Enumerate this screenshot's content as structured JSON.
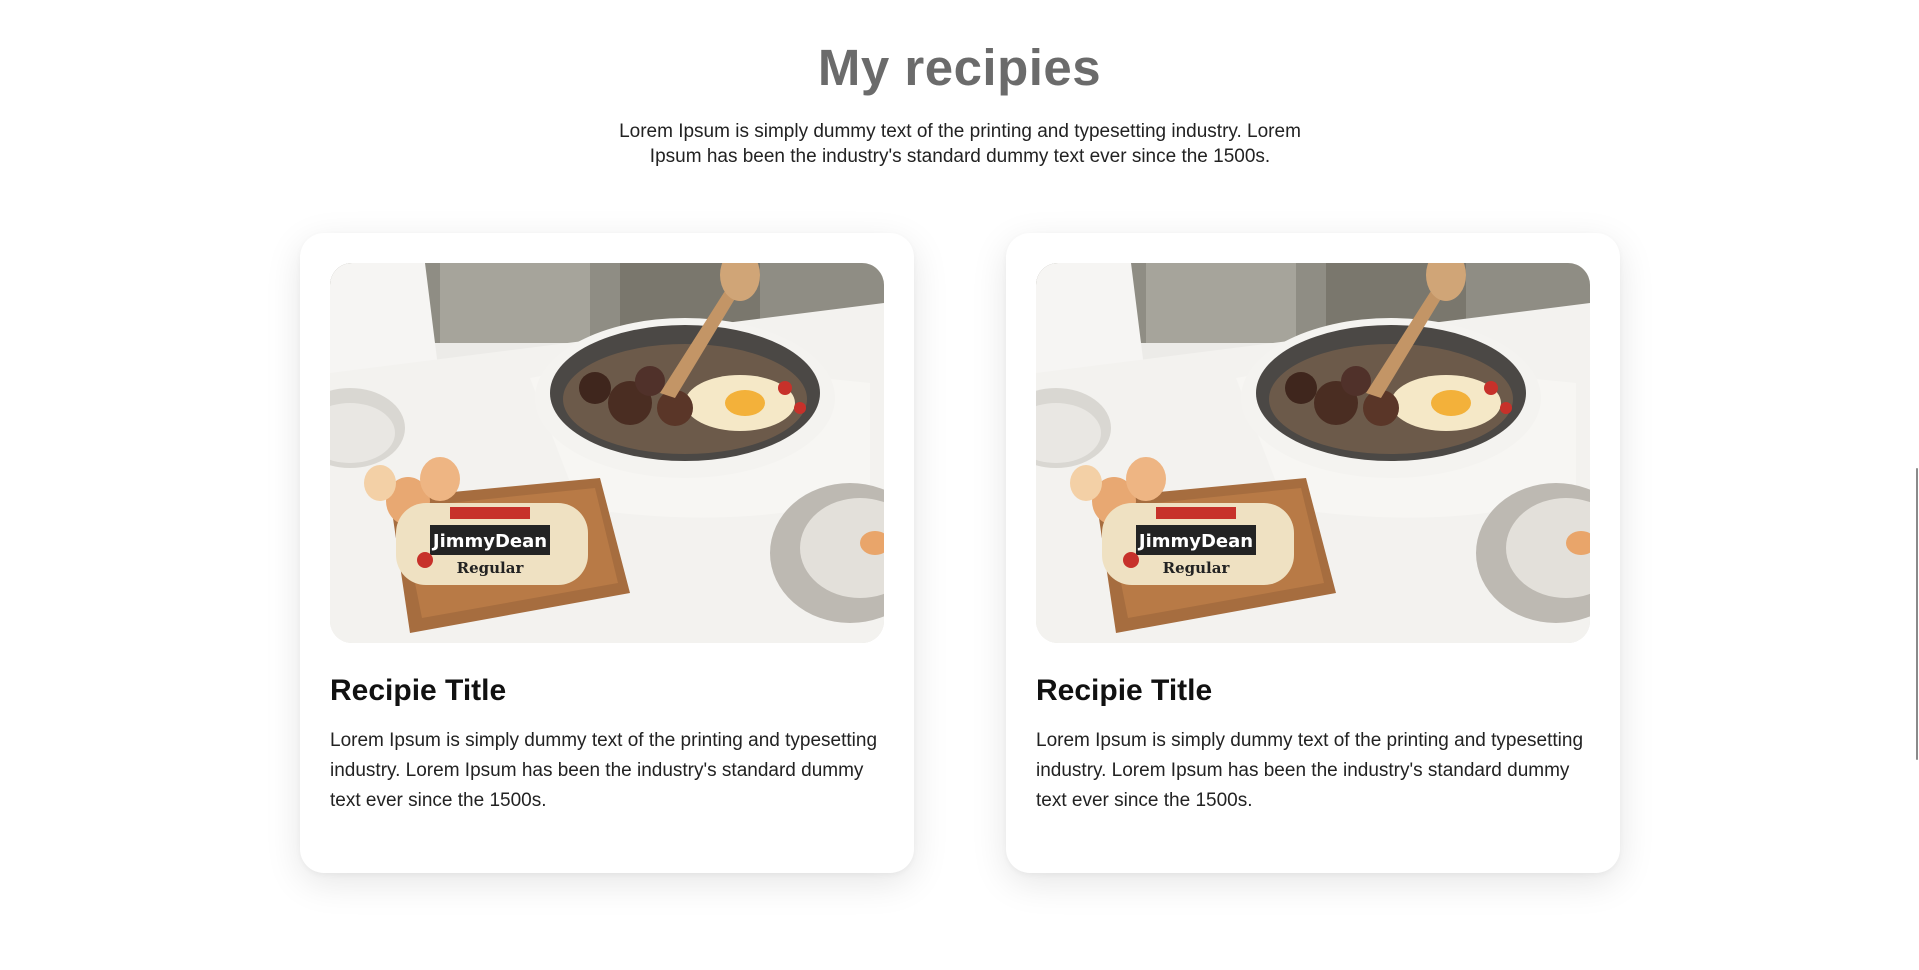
{
  "section": {
    "title": "My recipies",
    "intro": "Lorem Ipsum is simply dummy text of the printing and typesetting industry. Lorem Ipsum has been the industry's standard dummy text ever since the 1500s."
  },
  "recipes": [
    {
      "title": "Recipie Title",
      "description": "Lorem Ipsum is simply dummy text of the printing and typesetting industry. Lorem Ipsum has been the industry's standard dummy text ever since the 1500s.",
      "image_icon": "food-photo-icon",
      "package_brand": "JimmyDean",
      "package_variant": "Regular"
    },
    {
      "title": "Recipie Title",
      "description": "Lorem Ipsum is simply dummy text of the printing and typesetting industry. Lorem Ipsum has been the industry's standard dummy text ever since the 1500s.",
      "image_icon": "food-photo-icon",
      "package_brand": "JimmyDean",
      "package_variant": "Regular"
    }
  ],
  "colors": {
    "title": "#6b6b6b",
    "text": "#222222",
    "heading": "#111111",
    "background": "#ffffff"
  }
}
